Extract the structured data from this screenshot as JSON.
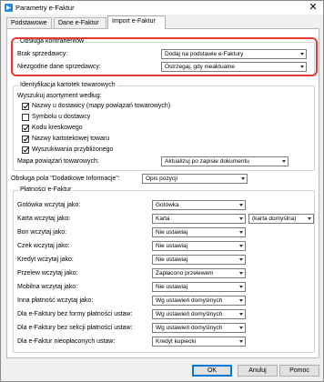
{
  "window": {
    "title": "Parametry e-Faktur",
    "close": "✕"
  },
  "tabs": [
    {
      "label": "Podstawowe"
    },
    {
      "label": "Dane e-Faktur"
    },
    {
      "label": "Import e-Faktur"
    }
  ],
  "kontrahenci": {
    "legend": "Obsługa kontrahentów",
    "brak_label": "Brak sprzedawcy:",
    "brak_value": "Dodaj na podstawie e-Faktury",
    "niezgodne_label": "Niezgodne dane sprzedawcy:",
    "niezgodne_value": "Ostrzegaj, gdy nieaktualne"
  },
  "kartoteki": {
    "legend": "Identyfikacja kartotek towarowych",
    "search_label": "Wyszukuj asortyment według:",
    "options": [
      {
        "label": "Nazwy u dostawcy (mapy powiązań towarowych)",
        "checked": true
      },
      {
        "label": "Symbolu u dostawcy",
        "checked": false
      },
      {
        "label": "Kodu kreskowego",
        "checked": true
      },
      {
        "label": "Nazwy kartotekowej towaru",
        "checked": true
      },
      {
        "label": "Wyszukiwania przybliżonego",
        "checked": true
      }
    ],
    "mapa_label": "Mapa powiązań towarowych:",
    "mapa_value": "Aktualizuj po zapisie dokumentu"
  },
  "dodatkowe": {
    "label": "Obsługa pola \"Dodatkowe Informacje\":",
    "value": "Opis pozycji"
  },
  "platnosci": {
    "legend": "Płatności e-Faktur",
    "rows": [
      {
        "label": "Gotówka wczytaj jako:",
        "value": "Gotówka"
      },
      {
        "label": "Karta wczytaj jako:",
        "value": "Karta",
        "extra": "(karta domyślna)"
      },
      {
        "label": "Bon wczytaj jako:",
        "value": "Nie ustawiaj"
      },
      {
        "label": "Czek wczytaj jako:",
        "value": "Nie ustawiaj"
      },
      {
        "label": "Kredyt wczytaj jako:",
        "value": "Nie ustawiaj"
      },
      {
        "label": "Przelew wczytaj jako:",
        "value": "Zapłacono przelewem"
      },
      {
        "label": "Mobilna wczytaj jako:",
        "value": "Nie ustawiaj"
      },
      {
        "label": "Inna płatność wczytaj jako:",
        "value": "Wg ustawień domyślnych"
      },
      {
        "label": "Dla e-Faktury bez formy płatności ustaw:",
        "value": "Wg ustawień domyślnych"
      },
      {
        "label": "Dla e-Faktury bez sekcji płatności ustaw:",
        "value": "Wg ustawień domyślnych"
      },
      {
        "label": "Dla e-Faktur nieopłaconych ustaw:",
        "value": "Kredyt kupiecki"
      }
    ]
  },
  "buttons": {
    "ok": "OK",
    "cancel": "Anuluj",
    "help": "Pomoc"
  },
  "colors": {
    "highlight": "#e53935",
    "accent": "#0078d7"
  }
}
